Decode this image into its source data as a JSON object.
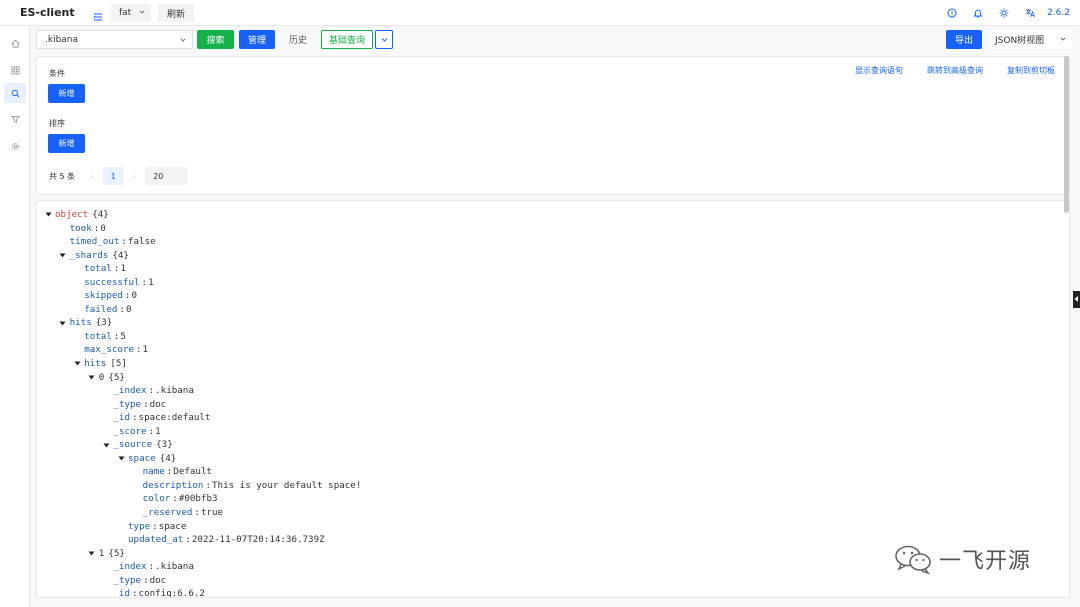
{
  "header": {
    "app_title": "ES-client",
    "env_value": "fat",
    "refresh_label": "刷新",
    "version": "2.6.2"
  },
  "toolbar": {
    "index_value": ".kibana",
    "search_label": "搜索",
    "manage_label": "管理",
    "history_label": "历史",
    "basic_query_label": "基础查询",
    "export_label": "导出",
    "view_mode": "JSON树视图"
  },
  "query": {
    "condition_label": "条件",
    "condition_add": "新增",
    "sort_label": "排序",
    "sort_add": "新增",
    "links": [
      "显示查询语句",
      "跳转到高级查询",
      "复制到剪切板"
    ],
    "total_text": "共 5 条",
    "current_page": "1",
    "page_size": "20",
    "prev_arrow": "‹",
    "next_arrow": "›"
  },
  "json_tree": [
    {
      "indent": 0,
      "toggle": true,
      "key": "object",
      "root": true,
      "count": "{4}"
    },
    {
      "indent": 1,
      "key": "took",
      "value": "0"
    },
    {
      "indent": 1,
      "key": "timed_out",
      "value": "false"
    },
    {
      "indent": 1,
      "toggle": true,
      "key": "_shards",
      "count": "{4}"
    },
    {
      "indent": 2,
      "key": "total",
      "value": "1"
    },
    {
      "indent": 2,
      "key": "successful",
      "value": "1"
    },
    {
      "indent": 2,
      "key": "skipped",
      "value": "0"
    },
    {
      "indent": 2,
      "key": "failed",
      "value": "0"
    },
    {
      "indent": 1,
      "toggle": true,
      "key": "hits",
      "count": "{3}"
    },
    {
      "indent": 2,
      "key": "total",
      "value": "5"
    },
    {
      "indent": 2,
      "key": "max_score",
      "value": "1"
    },
    {
      "indent": 2,
      "toggle": true,
      "key": "hits",
      "count": "[5]"
    },
    {
      "indent": 3,
      "toggle": true,
      "key": "0",
      "count": "{5}",
      "plain": true
    },
    {
      "indent": 4,
      "key": "_index",
      "value": ".kibana"
    },
    {
      "indent": 4,
      "key": "_type",
      "value": "doc"
    },
    {
      "indent": 4,
      "key": "_id",
      "value": "space:default"
    },
    {
      "indent": 4,
      "key": "_score",
      "value": "1"
    },
    {
      "indent": 4,
      "toggle": true,
      "key": "_source",
      "count": "{3}"
    },
    {
      "indent": 5,
      "toggle": true,
      "key": "space",
      "count": "{4}"
    },
    {
      "indent": 6,
      "key": "name",
      "value": "Default"
    },
    {
      "indent": 6,
      "key": "description",
      "value": "This is your default space!"
    },
    {
      "indent": 6,
      "key": "color",
      "value": "#00bfb3"
    },
    {
      "indent": 6,
      "key": "_reserved",
      "value": "true"
    },
    {
      "indent": 5,
      "key": "type",
      "value": "space"
    },
    {
      "indent": 5,
      "key": "updated_at",
      "value": "2022-11-07T20:14:36.739Z"
    },
    {
      "indent": 3,
      "toggle": true,
      "key": "1",
      "count": "{5}",
      "plain": true
    },
    {
      "indent": 4,
      "key": "_index",
      "value": ".kibana"
    },
    {
      "indent": 4,
      "key": "_type",
      "value": "doc"
    },
    {
      "indent": 4,
      "key": "_id",
      "value": "config:6.6.2"
    }
  ],
  "watermark": {
    "text": "一飞开源"
  },
  "colors": {
    "primary": "#1661ff",
    "success": "#12b14a",
    "json_key": "#1f5bb6",
    "json_root": "#d0423b"
  }
}
